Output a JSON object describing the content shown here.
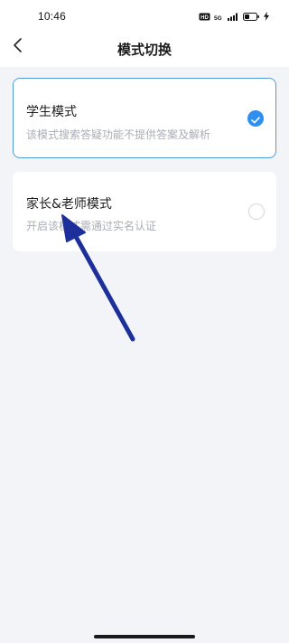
{
  "status_bar": {
    "time": "10:46",
    "network_label": "5G",
    "icons": [
      "hd-icon",
      "network-icon",
      "signal-icon",
      "battery-icon",
      "charging-icon"
    ]
  },
  "nav": {
    "back_icon": "chevron-left-icon",
    "title": "模式切换"
  },
  "modes": [
    {
      "title": "学生模式",
      "description": "该模式搜索答疑功能不提供答案及解析",
      "selected": true
    },
    {
      "title": "家长&老师模式",
      "description": "开启该模式需通过实名认证",
      "selected": false
    }
  ],
  "colors": {
    "accent": "#2f8ff0",
    "selected_border": "#4f9bd8",
    "annotation_arrow": "#1d2f9a",
    "background": "#f3f4f7"
  },
  "annotation": {
    "icon": "arrow-annotation"
  }
}
